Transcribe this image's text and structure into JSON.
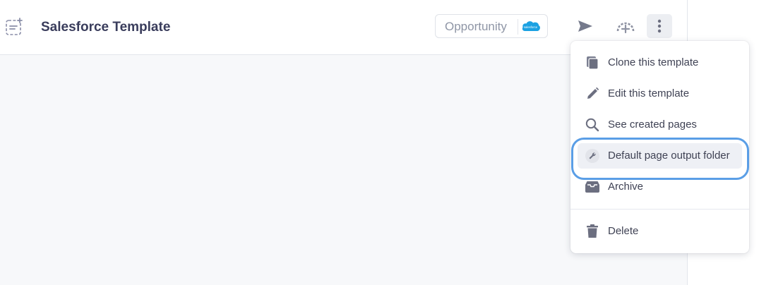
{
  "header": {
    "title": "Salesforce Template",
    "object_type": "Opportunity",
    "salesforce_logo_text": "salesforce"
  },
  "icons": {
    "template": "template-icon",
    "salesforce": "salesforce-cloud-icon",
    "run": "paper-plane-icon",
    "gauge": "gauge-plus-icon",
    "more": "vertical-dots-icon"
  },
  "menu": {
    "items": [
      {
        "label": "Clone this template",
        "icon": "copy-icon"
      },
      {
        "label": "Edit this template",
        "icon": "pencil-icon"
      },
      {
        "label": "See created pages",
        "icon": "magnifier-icon"
      },
      {
        "label": "Default page output folder",
        "icon": "wrench-icon",
        "highlighted": true
      },
      {
        "label": "Archive",
        "icon": "archive-icon"
      },
      {
        "label": "Delete",
        "icon": "trash-icon"
      }
    ]
  },
  "colors": {
    "accent_focus": "#5a9ee6",
    "text_primary": "#3a3d5c",
    "icon_gray": "#6c6f80",
    "salesforce_blue": "#1ba1e2"
  }
}
